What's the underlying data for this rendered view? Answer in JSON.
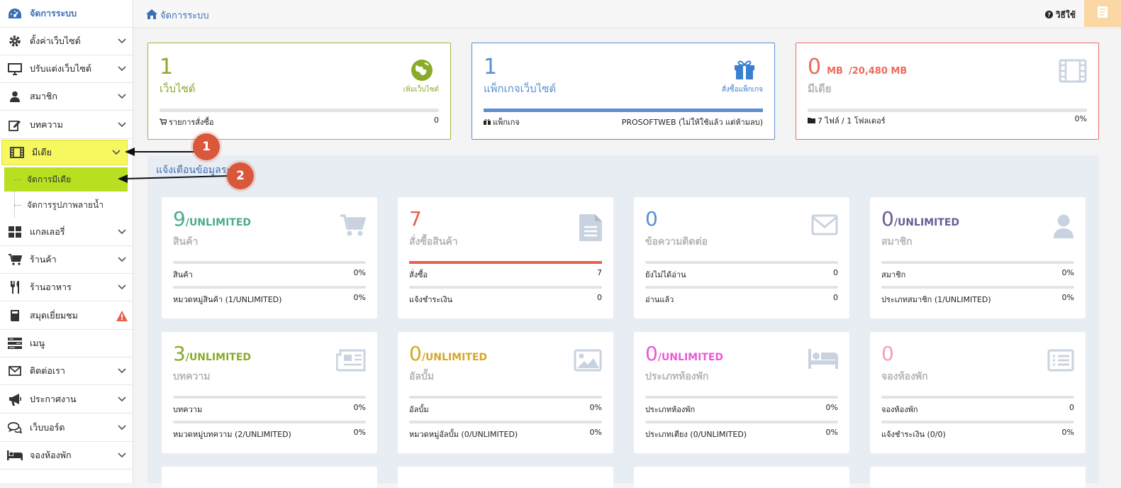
{
  "colors": {
    "accent": "#3b6fb6",
    "green": "#8aaa2a",
    "blue": "#5b8fd0",
    "red": "#e8604a",
    "highlight_yellow": "#f7f760",
    "highlight_green": "#b8e021",
    "badge": "#d9573a"
  },
  "sidebar": {
    "title": "จัดการระบบ",
    "items": [
      {
        "label": "ตั้งค่าเว็บไซต์",
        "icon": "gear-icon"
      },
      {
        "label": "ปรับแต่งเว็บไซต์",
        "icon": "monitor-icon"
      },
      {
        "label": "สมาชิก",
        "icon": "user-icon"
      },
      {
        "label": "บทความ",
        "icon": "edit-icon"
      },
      {
        "label": "มีเดีย",
        "icon": "film-icon"
      },
      {
        "label": "แกลเลอรี่",
        "icon": "grid-icon"
      },
      {
        "label": "ร้านค้า",
        "icon": "cart-icon"
      },
      {
        "label": "ร้านอาหาร",
        "icon": "utensils-icon"
      },
      {
        "label": "สมุดเยี่ยมชม",
        "icon": "book-icon"
      },
      {
        "label": "เมนู",
        "icon": "menu-icon"
      },
      {
        "label": "ติดต่อเรา",
        "icon": "envelope-icon"
      },
      {
        "label": "ประกาศงาน",
        "icon": "megaphone-icon"
      },
      {
        "label": "เว็บบอร์ด",
        "icon": "comments-icon"
      },
      {
        "label": "จองห้องพัก",
        "icon": "bed-icon"
      }
    ],
    "media_sub": [
      "จัดการมีเดีย",
      "จัดการรูปภาพลายน้ำ"
    ]
  },
  "topbar": {
    "breadcrumb": "จัดการระบบ",
    "help": "วิธีใช้"
  },
  "top_cards": [
    {
      "num": "1",
      "sub": "เว็บไซต์",
      "action": "เพิ่มเว็บไซต์",
      "foot_left": "รายการสั่งซื้อ",
      "foot_right": "0",
      "bar": 0
    },
    {
      "num": "1",
      "sub": "แพ็กเกจเว็บไซต์",
      "action": "สั่งซื้อแพ็กเกจ",
      "foot_left": "แพ็กเกจ",
      "foot_right": "PROSOFTWEB (ไม่ให้ใช้แล้ว แต่ห้ามลบ)",
      "bar": 1
    },
    {
      "num": "0",
      "unit": "MB",
      "limit": "/20,480 MB",
      "sub": "มีเดีย",
      "foot_left": "7 ไฟล์ / 1 โฟลเดอร์",
      "foot_right": "0%",
      "bar": 0
    }
  ],
  "notice_title": "แจ้งเตือนข้อมูลระ",
  "cards": [
    {
      "num": "9",
      "limit": "/UNLIMITED",
      "title": "สินค้า",
      "icon": "cart-icon",
      "color": "#4bab8c",
      "rows": [
        {
          "label": "สินค้า",
          "value": "0%",
          "fill": 0
        },
        {
          "label": "หมวดหมู่สินค้า (1/UNLIMITED)",
          "value": "0%",
          "fill": 0
        }
      ]
    },
    {
      "num": "7",
      "limit": "",
      "title": "สั่งซื้อสินค้า",
      "icon": "file-icon",
      "color": "#e8604a",
      "rows": [
        {
          "label": "สั่งซื้อ",
          "value": "7",
          "fill": 1
        },
        {
          "label": "แจ้งชำระเงิน",
          "value": "0",
          "fill": 0
        }
      ]
    },
    {
      "num": "0",
      "limit": "",
      "title": "ข้อความติดต่อ",
      "icon": "envelope-icon",
      "color": "#5b8fd0",
      "rows": [
        {
          "label": "ยังไม่ได้อ่าน",
          "value": "0",
          "fill": 0
        },
        {
          "label": "อ่านแล้ว",
          "value": "0",
          "fill": 0
        }
      ]
    },
    {
      "num": "0",
      "limit": "/UNLIMITED",
      "title": "สมาชิก",
      "icon": "user-icon",
      "color": "#6b5b95",
      "rows": [
        {
          "label": "สมาชิก",
          "value": "0%",
          "fill": 0
        },
        {
          "label": "ประเภทสมาชิก (1/UNLIMITED)",
          "value": "0%",
          "fill": 0
        }
      ]
    },
    {
      "num": "3",
      "limit": "/UNLIMITED",
      "title": "บทความ",
      "icon": "newspaper-icon",
      "color": "#8aaa2a",
      "rows": [
        {
          "label": "บทความ",
          "value": "0%",
          "fill": 0
        },
        {
          "label": "หมวดหมู่บทความ (2/UNLIMITED)",
          "value": "0%",
          "fill": 0
        }
      ]
    },
    {
      "num": "0",
      "limit": "/UNLIMITED",
      "title": "อัลบั้ม",
      "icon": "image-icon",
      "color": "#d6a625",
      "rows": [
        {
          "label": "อัลบั้ม",
          "value": "0%",
          "fill": 0
        },
        {
          "label": "หมวดหมู่อัลบั้ม (0/UNLIMITED)",
          "value": "0%",
          "fill": 0
        }
      ]
    },
    {
      "num": "0",
      "limit": "/UNLIMITED",
      "title": "ประเภทห้องพัก",
      "icon": "bed-icon",
      "color": "#e85ad8",
      "rows": [
        {
          "label": "ประเภทห้องพัก",
          "value": "0%",
          "fill": 0
        },
        {
          "label": "ประเภทเตียง (0/UNLIMITED)",
          "value": "0%",
          "fill": 0
        }
      ]
    },
    {
      "num": "0",
      "limit": "",
      "title": "จองห้องพัก",
      "icon": "list-icon",
      "color": "#f2a0b5",
      "rows": [
        {
          "label": "จองห้องพัก",
          "value": "0",
          "fill": 0
        },
        {
          "label": "แจ้งชำระเงิน (0/0)",
          "value": "0%",
          "fill": 0
        }
      ]
    }
  ],
  "badges": [
    "1",
    "2"
  ]
}
